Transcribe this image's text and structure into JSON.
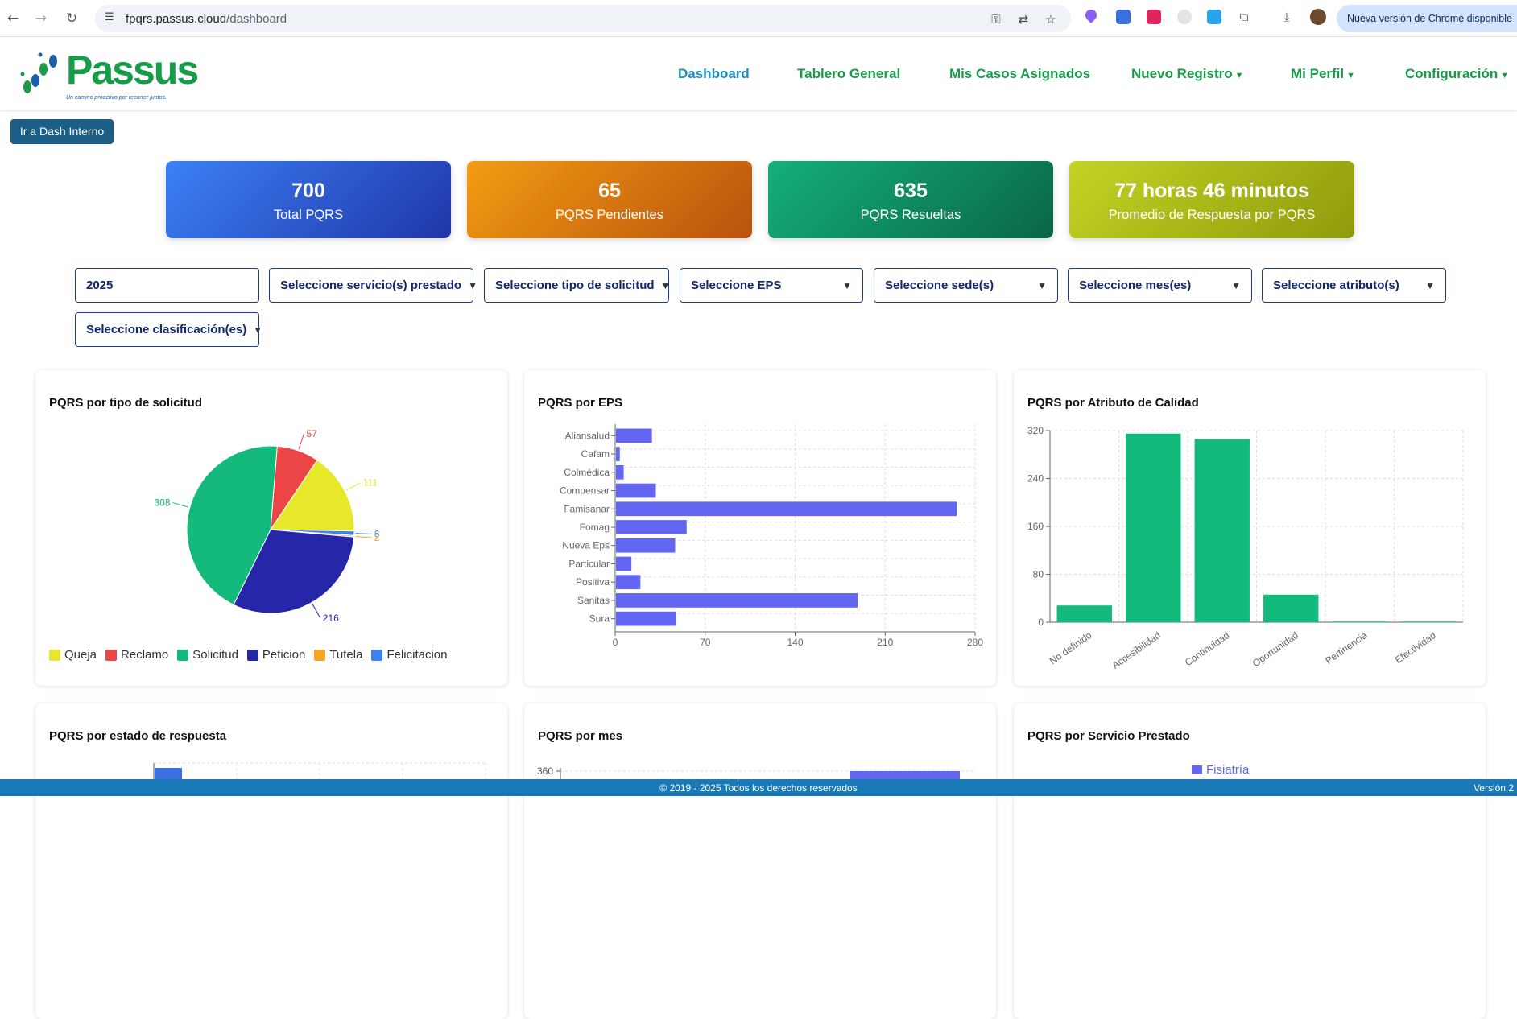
{
  "browser": {
    "url_host": "fpqrs.passus.cloud",
    "url_path": "/dashboard",
    "update_pill": "Nueva versión de Chrome disponible"
  },
  "site": {
    "logo_text": "Passus",
    "logo_tagline": "Un camino proactivo por recorrer juntos.",
    "nav": [
      {
        "label": "Dashboard",
        "active": true
      },
      {
        "label": "Tablero General"
      },
      {
        "label": "Mis Casos Asignados"
      },
      {
        "label": "Nuevo Registro",
        "dropdown": true
      },
      {
        "label": "Mi Perfil",
        "dropdown": true
      },
      {
        "label": "Configuración",
        "dropdown": true
      }
    ],
    "dash_interno_label": "Ir a Dash Interno"
  },
  "kpis": [
    {
      "value": "700",
      "label": "Total PQRS",
      "color_from": "#3b82f6",
      "color_to": "#2036a8"
    },
    {
      "value": "65",
      "label": "PQRS Pendientes",
      "color_from": "#f39c12",
      "color_to": "#b9520d"
    },
    {
      "value": "635",
      "label": "PQRS Resueltas",
      "color_from": "#14b07a",
      "color_to": "#0a6646"
    },
    {
      "value": "77 horas 46 minutos",
      "label": "Promedio de Respuesta por PQRS",
      "color_from": "#c3d424",
      "color_to": "#8f9a0c"
    }
  ],
  "filters": {
    "year": "2025",
    "servicio": "Seleccione servicio(s) prestado",
    "tipo": "Seleccione tipo de solicitud",
    "eps": "Seleccione EPS",
    "sede": "Seleccione sede(s)",
    "mes": "Seleccione mes(es)",
    "atributo": "Seleccione atributo(s)",
    "clasificacion": "Seleccione clasificación(es)"
  },
  "cards": {
    "tipo_title": "PQRS por tipo de solicitud",
    "eps_title": "PQRS por EPS",
    "atributo_title": "PQRS por Atributo de Calidad",
    "estado_title": "PQRS por estado de respuesta",
    "mes_title": "PQRS por mes",
    "servicio_title": "PQRS por Servicio Prestado",
    "servicio_legend": "Fisiatría",
    "mes_ytick": "360"
  },
  "chart_data": [
    {
      "type": "pie",
      "title": "PQRS por tipo de solicitud",
      "series": [
        {
          "name": "Queja",
          "value": 111,
          "color": "#e8e82a"
        },
        {
          "name": "Reclamo",
          "value": 57,
          "color": "#ec4545"
        },
        {
          "name": "Solicitud",
          "value": 308,
          "color": "#14b97c"
        },
        {
          "name": "Peticion",
          "value": 216,
          "color": "#2526a8"
        },
        {
          "name": "Tutela",
          "value": 2,
          "color": "#f5a623"
        },
        {
          "name": "Felicitacion",
          "value": 6,
          "color": "#3b82f6"
        }
      ]
    },
    {
      "type": "bar",
      "orientation": "horizontal",
      "title": "PQRS por EPS",
      "categories": [
        "Aliansalud",
        "Cafam",
        "Colmédica",
        "Compensar",
        "Famisanar",
        "Fomag",
        "Nueva Eps",
        "Particular",
        "Positiva",
        "Sanitas",
        "Sura"
      ],
      "values": [
        28,
        3,
        6,
        31,
        265,
        55,
        46,
        12,
        19,
        188,
        47
      ],
      "xlim": [
        0,
        280
      ],
      "xticks": [
        0,
        70,
        140,
        210,
        280
      ],
      "color": "#6366f1",
      "grid": true
    },
    {
      "type": "bar",
      "title": "PQRS por Atributo de Calidad",
      "categories": [
        "No definido",
        "Accesibilidad",
        "Continuidad",
        "Oportunidad",
        "Pertinencia",
        "Efectividad"
      ],
      "values": [
        28,
        315,
        306,
        46,
        1,
        1
      ],
      "ylim": [
        0,
        320
      ],
      "yticks": [
        0,
        80,
        160,
        240,
        320
      ],
      "color": "#14b97c",
      "grid": true
    }
  ]
}
